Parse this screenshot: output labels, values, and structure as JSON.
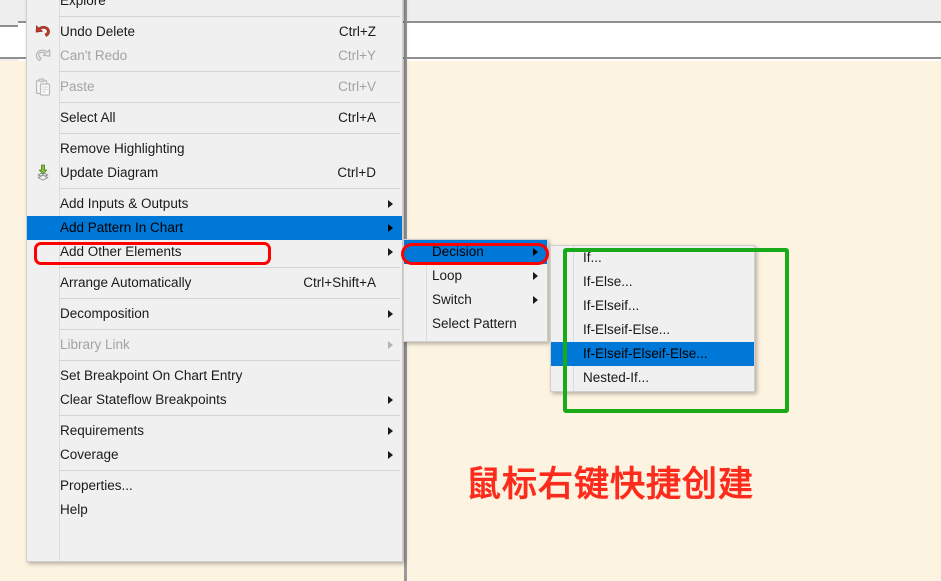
{
  "window": {
    "canvas_background": "#fdf3e1",
    "toolbar_background": "#eeeeee"
  },
  "context_menu": {
    "name": "Stateflow chart context menu",
    "items": [
      {
        "id": "explore",
        "label": "Explore",
        "accel": "",
        "icon": "",
        "arrow": false,
        "disabled": false,
        "selected": false
      },
      {
        "id": "sep1",
        "type": "separator"
      },
      {
        "id": "undo-delete",
        "label": "Undo Delete",
        "accel": "Ctrl+Z",
        "icon": "undo-icon",
        "arrow": false,
        "disabled": false,
        "selected": false
      },
      {
        "id": "cant-redo",
        "label": "Can't Redo",
        "accel": "Ctrl+Y",
        "icon": "redo-icon",
        "arrow": false,
        "disabled": true,
        "selected": false
      },
      {
        "id": "sep2",
        "type": "separator"
      },
      {
        "id": "paste",
        "label": "Paste",
        "accel": "Ctrl+V",
        "icon": "paste-icon",
        "arrow": false,
        "disabled": true,
        "selected": false
      },
      {
        "id": "sep3",
        "type": "separator"
      },
      {
        "id": "select-all",
        "label": "Select All",
        "accel": "Ctrl+A",
        "icon": "",
        "arrow": false,
        "disabled": false,
        "selected": false
      },
      {
        "id": "sep4",
        "type": "separator"
      },
      {
        "id": "remove-highlighting",
        "label": "Remove Highlighting",
        "accel": "",
        "icon": "",
        "arrow": false,
        "disabled": false,
        "selected": false
      },
      {
        "id": "update-diagram",
        "label": "Update Diagram",
        "accel": "Ctrl+D",
        "icon": "update-diagram-icon",
        "arrow": false,
        "disabled": false,
        "selected": false
      },
      {
        "id": "sep5",
        "type": "separator"
      },
      {
        "id": "add-inputs-outputs",
        "label": "Add Inputs & Outputs",
        "accel": "",
        "icon": "",
        "arrow": true,
        "disabled": false,
        "selected": false
      },
      {
        "id": "add-pattern-in-chart",
        "label": "Add Pattern In Chart",
        "accel": "",
        "icon": "",
        "arrow": true,
        "disabled": false,
        "selected": true
      },
      {
        "id": "add-other-elements",
        "label": "Add Other Elements",
        "accel": "",
        "icon": "",
        "arrow": true,
        "disabled": false,
        "selected": false
      },
      {
        "id": "sep6",
        "type": "separator"
      },
      {
        "id": "arrange-automatically",
        "label": "Arrange Automatically",
        "accel": "Ctrl+Shift+A",
        "icon": "",
        "arrow": false,
        "disabled": false,
        "selected": false
      },
      {
        "id": "sep7",
        "type": "separator"
      },
      {
        "id": "decomposition",
        "label": "Decomposition",
        "accel": "",
        "icon": "",
        "arrow": true,
        "disabled": false,
        "selected": false
      },
      {
        "id": "sep8",
        "type": "separator"
      },
      {
        "id": "library-link",
        "label": "Library Link",
        "accel": "",
        "icon": "",
        "arrow": true,
        "disabled": true,
        "selected": false
      },
      {
        "id": "sep9",
        "type": "separator"
      },
      {
        "id": "set-breakpoint-on-chart-entry",
        "label": "Set Breakpoint On Chart Entry",
        "accel": "",
        "icon": "",
        "arrow": false,
        "disabled": false,
        "selected": false
      },
      {
        "id": "clear-stateflow-breakpoints",
        "label": "Clear Stateflow Breakpoints",
        "accel": "",
        "icon": "",
        "arrow": true,
        "disabled": false,
        "selected": false
      },
      {
        "id": "sep10",
        "type": "separator"
      },
      {
        "id": "requirements",
        "label": "Requirements",
        "accel": "",
        "icon": "",
        "arrow": true,
        "disabled": false,
        "selected": false
      },
      {
        "id": "coverage",
        "label": "Coverage",
        "accel": "",
        "icon": "",
        "arrow": true,
        "disabled": false,
        "selected": false
      },
      {
        "id": "sep11",
        "type": "separator"
      },
      {
        "id": "properties",
        "label": "Properties...",
        "accel": "",
        "icon": "",
        "arrow": false,
        "disabled": false,
        "selected": false
      },
      {
        "id": "help",
        "label": "Help",
        "accel": "",
        "icon": "",
        "arrow": false,
        "disabled": false,
        "selected": false
      }
    ]
  },
  "submenu_pattern": {
    "name": "Add Pattern In Chart submenu",
    "items": [
      {
        "id": "decision",
        "label": "Decision",
        "arrow": true,
        "selected": true
      },
      {
        "id": "loop",
        "label": "Loop",
        "arrow": true,
        "selected": false
      },
      {
        "id": "switch",
        "label": "Switch",
        "arrow": true,
        "selected": false
      },
      {
        "id": "select-pattern",
        "label": "Select Pattern",
        "arrow": false,
        "selected": false
      }
    ]
  },
  "submenu_decision": {
    "name": "Decision submenu",
    "items": [
      {
        "id": "if",
        "label": "If...",
        "selected": false
      },
      {
        "id": "if-else",
        "label": "If-Else...",
        "selected": false
      },
      {
        "id": "if-elseif",
        "label": "If-Elseif...",
        "selected": false
      },
      {
        "id": "if-elseif-else",
        "label": "If-Elseif-Else...",
        "selected": false
      },
      {
        "id": "if-elseif-elseif-else",
        "label": "If-Elseif-Elseif-Else...",
        "selected": true
      },
      {
        "id": "nested-if",
        "label": "Nested-If...",
        "selected": false
      }
    ]
  },
  "annotations": {
    "chinese_caption": "鼠标右键快捷创建",
    "caption_color": "#fd2b1c",
    "red_highlight_color": "#ff0000",
    "green_highlight_color": "#18aa18",
    "selection_color": "#0078d7",
    "red_boxes": [
      {
        "id": "red-box-add-pattern-in-chart",
        "target": "Add Pattern In Chart"
      },
      {
        "id": "red-box-decision",
        "target": "Decision"
      }
    ],
    "green_boxes": [
      {
        "id": "green-box-decision-submenu",
        "target": "Decision submenu"
      }
    ]
  }
}
